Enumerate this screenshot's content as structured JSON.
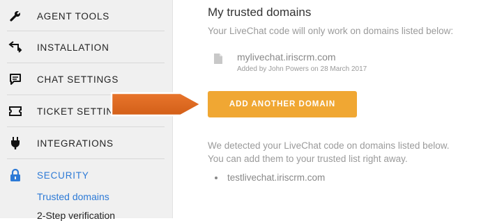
{
  "sidebar": {
    "items": [
      {
        "label": "AGENT TOOLS",
        "icon": "wrench-icon"
      },
      {
        "label": "INSTALLATION",
        "icon": "install-arrows-icon"
      },
      {
        "label": "CHAT SETTINGS",
        "icon": "chat-bubble-icon"
      },
      {
        "label": "TICKET SETTINGS",
        "icon": "ticket-icon"
      },
      {
        "label": "INTEGRATIONS",
        "icon": "plug-icon"
      },
      {
        "label": "SECURITY",
        "icon": "lock-icon",
        "active": true
      }
    ],
    "sub_items": [
      {
        "label": "Trusted domains",
        "active": true
      },
      {
        "label": "2-Step verification",
        "active": false
      }
    ]
  },
  "main": {
    "title": "My trusted domains",
    "description": "Your LiveChat code will only work on domains listed below:",
    "trusted_domain": {
      "name": "mylivechat.iriscrm.com",
      "meta": "Added by John Powers on 28 March 2017",
      "icon": "document-icon"
    },
    "add_button_label": "ADD ANOTHER DOMAIN",
    "detected_line1": "We detected your LiveChat code on domains listed below.",
    "detected_line2": "You can add them to your trusted list right away.",
    "detected_domain": "testlivechat.iriscrm.com"
  },
  "colors": {
    "accent_blue": "#2d7ad6",
    "button_orange": "#f0a733",
    "pointer_arrow": "#e06a22"
  }
}
